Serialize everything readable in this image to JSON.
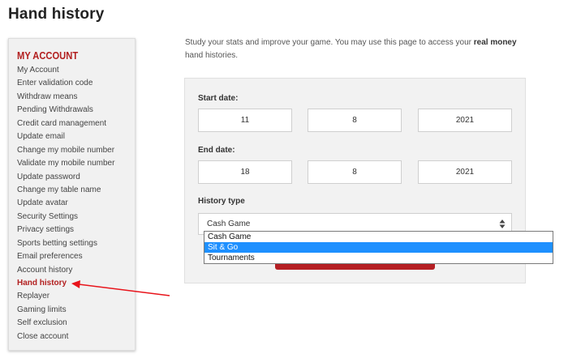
{
  "page": {
    "title": "Hand history"
  },
  "sidebar": {
    "heading": "MY ACCOUNT",
    "items": [
      "My Account",
      "Enter validation code",
      "Withdraw means",
      "Pending Withdrawals",
      "Credit card management",
      "Update email",
      "Change my mobile number",
      "Validate my mobile number",
      "Update password",
      "Change my table name",
      "Update avatar",
      "Security Settings",
      "Privacy settings",
      "Sports betting settings",
      "Email preferences",
      "Account history",
      "Hand history",
      "Replayer",
      "Gaming limits",
      "Self exclusion",
      "Close account"
    ],
    "active_item": "Hand history"
  },
  "intro": {
    "text_before": "Study your stats and improve your game. You may use this page to access your ",
    "text_bold": "real money",
    "text_after": " hand histories."
  },
  "form": {
    "start_label": "Start date:",
    "start_day": "11",
    "start_month": "8",
    "start_year": "2021",
    "end_label": "End date:",
    "end_day": "18",
    "end_month": "8",
    "end_year": "2021",
    "history_type_label": "History type",
    "history_type_value": "Cash Game",
    "history_type_options": [
      "Cash Game",
      "Sit & Go",
      "Tournaments"
    ],
    "highlighted_option": "Sit & Go"
  },
  "colors": {
    "accent": "#b21f1f",
    "highlight": "#1e90ff",
    "annotation_arrow": "#e8141b"
  },
  "icons": {
    "select_arrows": "updown-arrows-icon"
  }
}
